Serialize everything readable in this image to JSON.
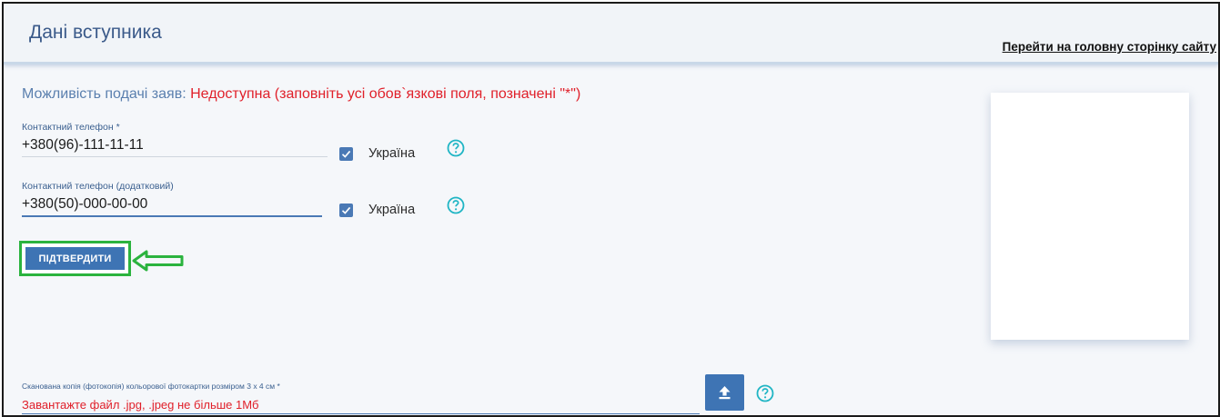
{
  "header": {
    "title": "Дані вступника",
    "home_link": "Перейти на головну сторінку сайту"
  },
  "status": {
    "label": "Можливість подачі заяв:",
    "value": "Недоступна (заповніть усі обов`язкові поля, позначені \"*\")"
  },
  "phone_main": {
    "label": "Контактний телефон *",
    "value": "+380(96)-111-11-11",
    "country_checkbox_label": "Україна",
    "country_checked": true
  },
  "phone_extra": {
    "label": "Контактний телефон (додатковий)",
    "value": "+380(50)-000-00-00",
    "country_checkbox_label": "Україна",
    "country_checked": true
  },
  "confirm_button": {
    "label": "ПІДТВЕРДИТИ"
  },
  "photo_upload": {
    "label": "Сканована копія (фотокопія) кольорової фотокартки розміром 3 х 4 см *",
    "hint": "Завантажте файл .jpg, .jpeg не більше 1Мб"
  },
  "colors": {
    "accent": "#3e74b4",
    "error": "#e0202a",
    "highlight": "#2bb33e",
    "help": "#1fb5c4"
  },
  "icons": {
    "help": "question-circle-icon",
    "upload": "upload-arrow-icon",
    "check": "check-icon",
    "pointer": "left-arrow-icon"
  }
}
